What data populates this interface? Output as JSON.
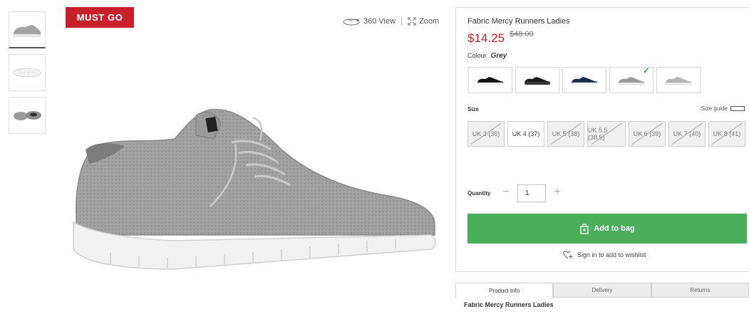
{
  "badge": "MUST GO",
  "view_tools": {
    "view360": "360 View",
    "zoom": "Zoom"
  },
  "product": {
    "title": "Fabric Mercy Runners Ladies",
    "price": "$14.25",
    "old_price": "$48.00",
    "colour_label": "Colour",
    "colour_value": "Grey"
  },
  "swatches": [
    {
      "name": "black-white",
      "color": "#111111",
      "sole": "#ffffff",
      "selected": false
    },
    {
      "name": "black-black",
      "color": "#1a1a1a",
      "sole": "#222222",
      "selected": false
    },
    {
      "name": "navy",
      "color": "#1d2a4a",
      "sole": "#ffffff",
      "selected": false
    },
    {
      "name": "grey",
      "color": "#9a9a9a",
      "sole": "#eeeeee",
      "selected": true
    },
    {
      "name": "light-grey",
      "color": "#b5b5b5",
      "sole": "#eeeeee",
      "selected": false
    }
  ],
  "size": {
    "label": "Size",
    "guide": "Size guide",
    "options": [
      {
        "label": "UK 3 (36)",
        "available": false
      },
      {
        "label": "UK 4 (37)",
        "available": true
      },
      {
        "label": "UK 5 (38)",
        "available": false
      },
      {
        "label": "UK 5.5 (38.5)",
        "available": false
      },
      {
        "label": "UK 6 (39)",
        "available": false
      },
      {
        "label": "UK 7 (40)",
        "available": false
      },
      {
        "label": "UK 8 (41)",
        "available": false
      }
    ]
  },
  "quantity": {
    "label": "Quantity",
    "value": "1",
    "minus": "−",
    "plus": "+"
  },
  "add_to_bag": "Add to bag",
  "wishlist": "Sign in to add to wishlist",
  "tabs": [
    "Product Info",
    "Delivery",
    "Returns"
  ],
  "tab_heading": "Fabric Mercy Runners Ladies",
  "colors": {
    "sale_red": "#c8202b",
    "cta_green": "#4bae5a",
    "shoe_grey": "#9b9b9b"
  }
}
